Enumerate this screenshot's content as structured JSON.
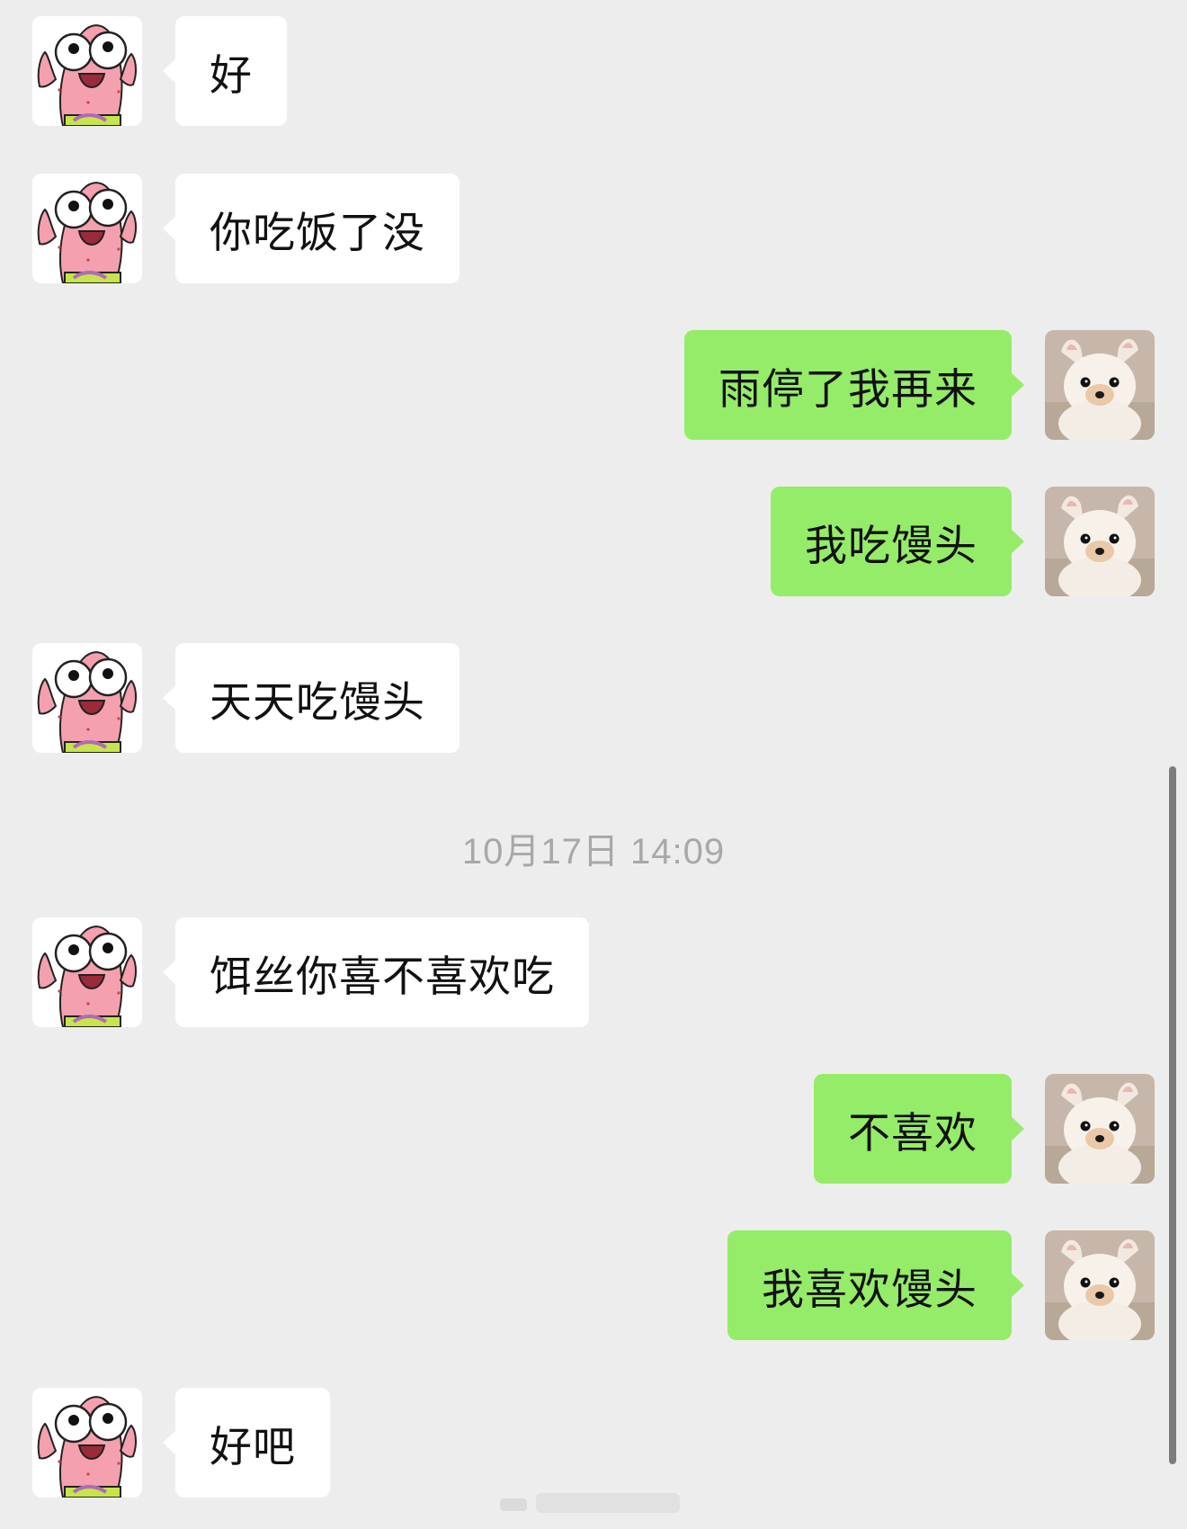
{
  "timestamp": "10月17日 14:09",
  "avatars": {
    "left": "patrick-star-avatar",
    "right": "white-puppy-avatar"
  },
  "colors": {
    "background": "#ededed",
    "incoming_bubble": "#ffffff",
    "outgoing_bubble": "#95ec69",
    "text": "#111111",
    "timestamp": "#a8a8a8"
  },
  "messages": [
    {
      "side": "left",
      "text": "好"
    },
    {
      "side": "left",
      "text": "你吃饭了没"
    },
    {
      "side": "right",
      "text": "雨停了我再来"
    },
    {
      "side": "right",
      "text": "我吃馒头"
    },
    {
      "side": "left",
      "text": "天天吃馒头"
    },
    {
      "side": "left",
      "text": "饵丝你喜不喜欢吃"
    },
    {
      "side": "right",
      "text": "不喜欢"
    },
    {
      "side": "right",
      "text": "我喜欢馒头"
    },
    {
      "side": "left",
      "text": "好吧"
    }
  ]
}
